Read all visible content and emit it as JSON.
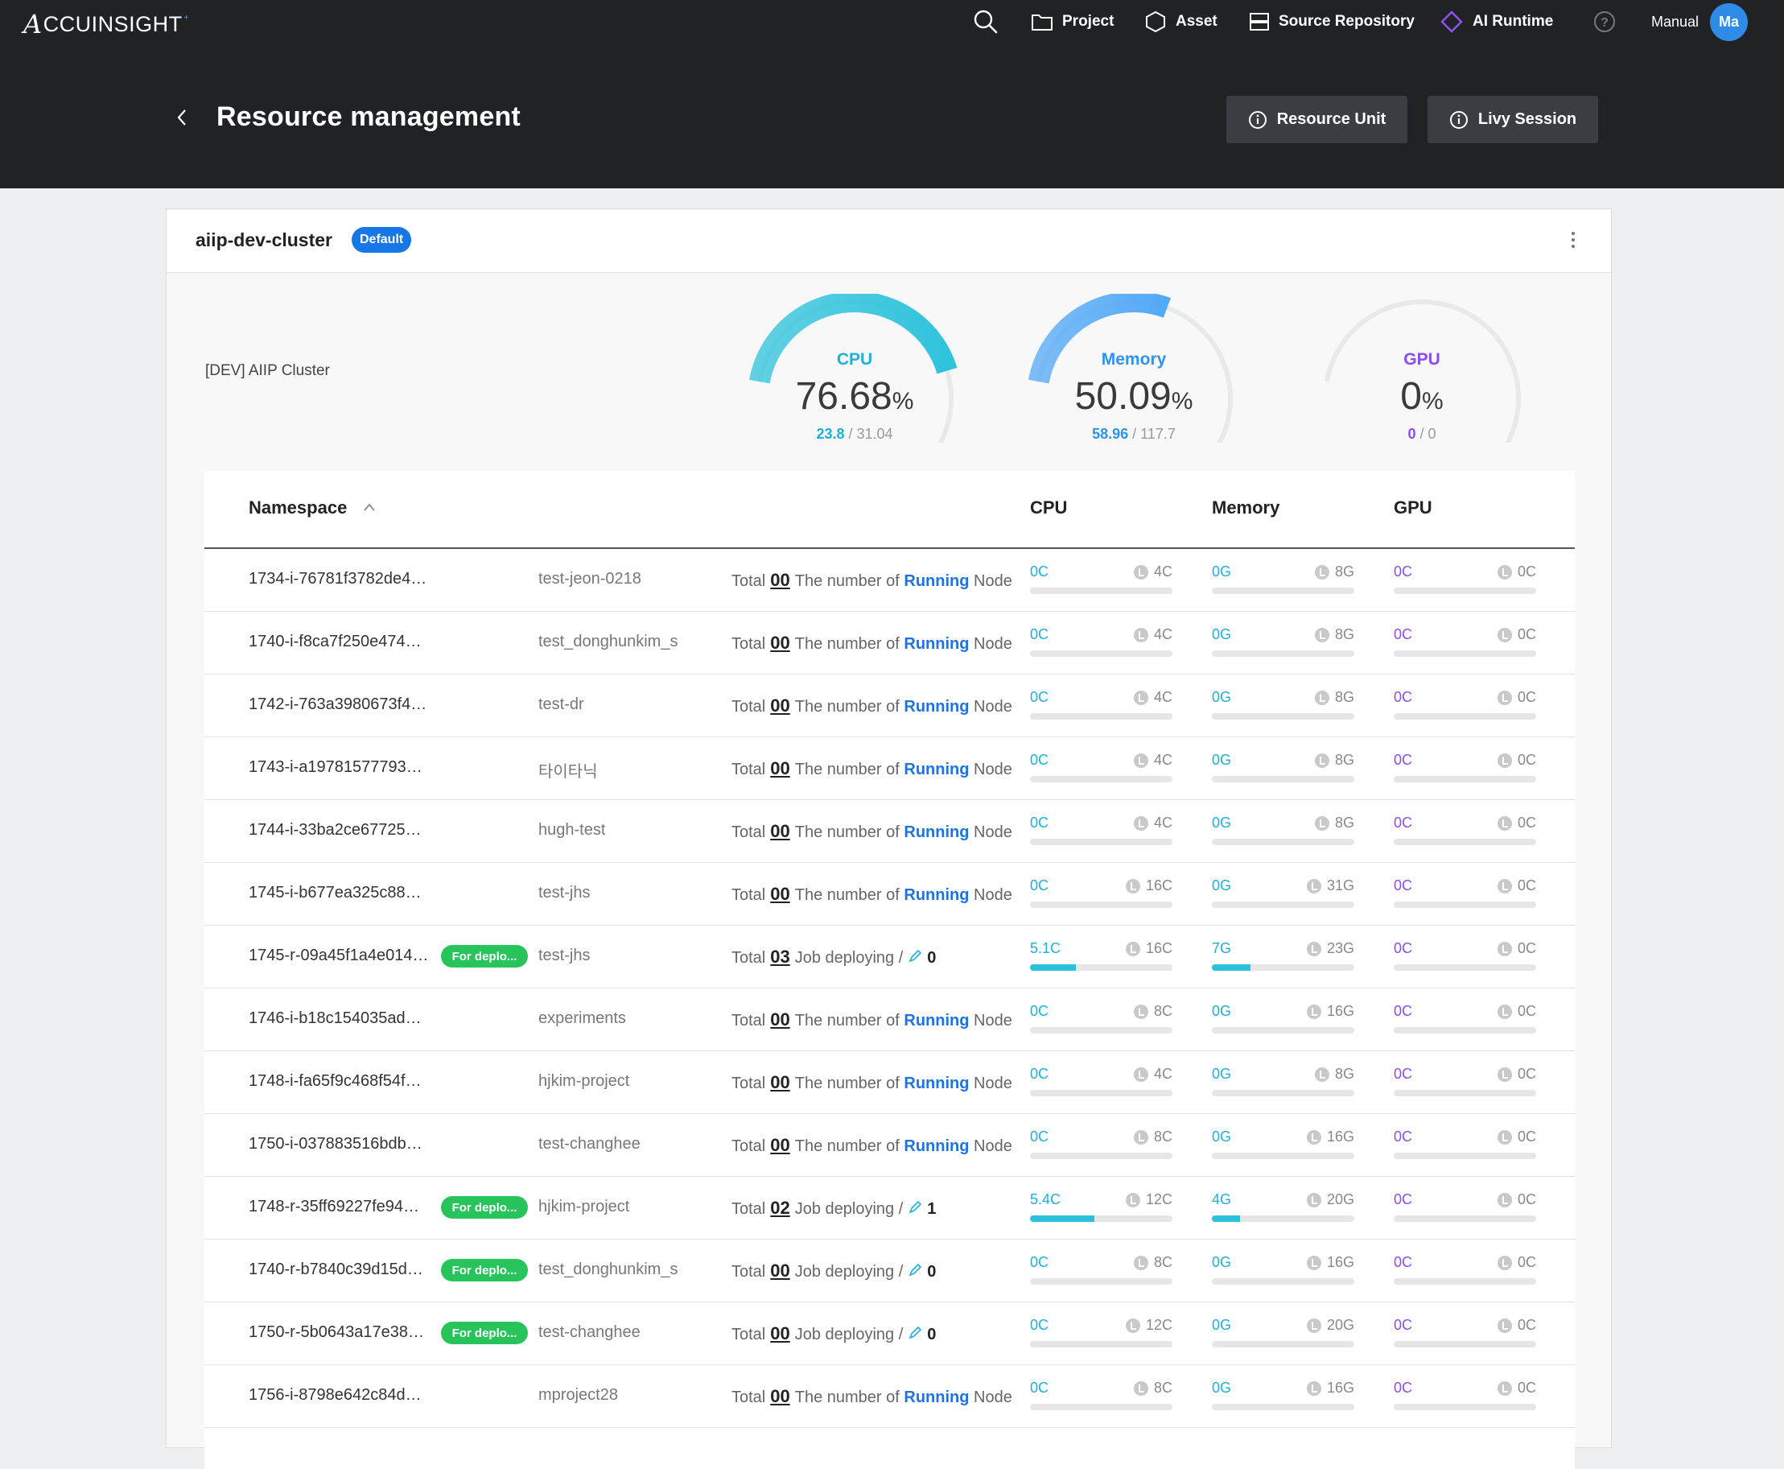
{
  "header": {
    "logo": "CCUINSIGHT",
    "logo_mark": "A",
    "nav": {
      "project": "Project",
      "asset": "Asset",
      "source_repository": "Source Repository",
      "ai_runtime": "AI Runtime"
    },
    "manual": "Manual",
    "avatar": "Ma",
    "page_title": "Resource management",
    "buttons": {
      "resource_unit": "Resource Unit",
      "livy_session": "Livy Session"
    }
  },
  "cluster": {
    "name": "aiip-dev-cluster",
    "badge": "Default",
    "description": "[DEV] AIIP Cluster",
    "gauges": {
      "cpu": {
        "label": "CPU",
        "value": "76.68",
        "unit": "%",
        "used": "23.8",
        "total": "31.04",
        "fraction": 0.7668,
        "color": "#2fc3dc"
      },
      "memory": {
        "label": "Memory",
        "value": "50.09",
        "unit": "%",
        "used": "58.96",
        "total": "117.7",
        "fraction": 0.5009,
        "color": "#52a9f7"
      },
      "gpu": {
        "label": "GPU",
        "value": "0",
        "unit": "%",
        "used": "0",
        "total": "0",
        "fraction": 0,
        "color": "#8a4df0"
      }
    }
  },
  "table": {
    "headers": {
      "namespace": "Namespace",
      "cpu": "CPU",
      "memory": "Memory",
      "gpu": "GPU"
    },
    "labels": {
      "total": "Total",
      "the_number_of": "The number of",
      "running": "Running",
      "node": "Node",
      "job_deploying": "Job deploying /"
    },
    "rows": [
      {
        "id": "1734-i-76781f3782de4…",
        "badge": "",
        "project": "test-jeon-0218",
        "kind": "running",
        "total": "00",
        "deploy": "",
        "cpu_used": "0C",
        "cpu_lim": "4C",
        "cpu_frac": 0,
        "mem_used": "0G",
        "mem_lim": "8G",
        "mem_frac": 0,
        "gpu_used": "0C",
        "gpu_lim": "0C"
      },
      {
        "id": "1740-i-f8ca7f250e474…",
        "badge": "",
        "project": "test_donghunkim_s",
        "kind": "running",
        "total": "00",
        "deploy": "",
        "cpu_used": "0C",
        "cpu_lim": "4C",
        "cpu_frac": 0,
        "mem_used": "0G",
        "mem_lim": "8G",
        "mem_frac": 0,
        "gpu_used": "0C",
        "gpu_lim": "0C"
      },
      {
        "id": "1742-i-763a3980673f4…",
        "badge": "",
        "project": "test-dr",
        "kind": "running",
        "total": "00",
        "deploy": "",
        "cpu_used": "0C",
        "cpu_lim": "4C",
        "cpu_frac": 0,
        "mem_used": "0G",
        "mem_lim": "8G",
        "mem_frac": 0,
        "gpu_used": "0C",
        "gpu_lim": "0C"
      },
      {
        "id": "1743-i-a19781577793…",
        "badge": "",
        "project": "타이타닉",
        "kind": "running",
        "total": "00",
        "deploy": "",
        "cpu_used": "0C",
        "cpu_lim": "4C",
        "cpu_frac": 0,
        "mem_used": "0G",
        "mem_lim": "8G",
        "mem_frac": 0,
        "gpu_used": "0C",
        "gpu_lim": "0C"
      },
      {
        "id": "1744-i-33ba2ce67725…",
        "badge": "",
        "project": "hugh-test",
        "kind": "running",
        "total": "00",
        "deploy": "",
        "cpu_used": "0C",
        "cpu_lim": "4C",
        "cpu_frac": 0,
        "mem_used": "0G",
        "mem_lim": "8G",
        "mem_frac": 0,
        "gpu_used": "0C",
        "gpu_lim": "0C"
      },
      {
        "id": "1745-i-b677ea325c88…",
        "badge": "",
        "project": "test-jhs",
        "kind": "running",
        "total": "00",
        "deploy": "",
        "cpu_used": "0C",
        "cpu_lim": "16C",
        "cpu_frac": 0,
        "mem_used": "0G",
        "mem_lim": "31G",
        "mem_frac": 0,
        "gpu_used": "0C",
        "gpu_lim": "0C"
      },
      {
        "id": "1745-r-09a45f1a4e014…",
        "badge": "For deplo...",
        "project": "test-jhs",
        "kind": "deploying",
        "total": "03",
        "deploy": "0",
        "cpu_used": "5.1C",
        "cpu_lim": "16C",
        "cpu_frac": 0.32,
        "mem_used": "7G",
        "mem_lim": "23G",
        "mem_frac": 0.27,
        "gpu_used": "0C",
        "gpu_lim": "0C"
      },
      {
        "id": "1746-i-b18c154035ad…",
        "badge": "",
        "project": "experiments",
        "kind": "running",
        "total": "00",
        "deploy": "",
        "cpu_used": "0C",
        "cpu_lim": "8C",
        "cpu_frac": 0,
        "mem_used": "0G",
        "mem_lim": "16G",
        "mem_frac": 0,
        "gpu_used": "0C",
        "gpu_lim": "0C"
      },
      {
        "id": "1748-i-fa65f9c468f54f…",
        "badge": "",
        "project": "hjkim-project",
        "kind": "running",
        "total": "00",
        "deploy": "",
        "cpu_used": "0C",
        "cpu_lim": "4C",
        "cpu_frac": 0,
        "mem_used": "0G",
        "mem_lim": "8G",
        "mem_frac": 0,
        "gpu_used": "0C",
        "gpu_lim": "0C"
      },
      {
        "id": "1750-i-037883516bdb…",
        "badge": "",
        "project": "test-changhee",
        "kind": "running",
        "total": "00",
        "deploy": "",
        "cpu_used": "0C",
        "cpu_lim": "8C",
        "cpu_frac": 0,
        "mem_used": "0G",
        "mem_lim": "16G",
        "mem_frac": 0,
        "gpu_used": "0C",
        "gpu_lim": "0C"
      },
      {
        "id": "1748-r-35ff69227fe94…",
        "badge": "For deplo...",
        "project": "hjkim-project",
        "kind": "deploying",
        "total": "02",
        "deploy": "1",
        "cpu_used": "5.4C",
        "cpu_lim": "12C",
        "cpu_frac": 0.45,
        "mem_used": "4G",
        "mem_lim": "20G",
        "mem_frac": 0.2,
        "gpu_used": "0C",
        "gpu_lim": "0C"
      },
      {
        "id": "1740-r-b7840c39d15d…",
        "badge": "For deplo...",
        "project": "test_donghunkim_s",
        "kind": "deploying",
        "total": "00",
        "deploy": "0",
        "cpu_used": "0C",
        "cpu_lim": "8C",
        "cpu_frac": 0,
        "mem_used": "0G",
        "mem_lim": "16G",
        "mem_frac": 0,
        "gpu_used": "0C",
        "gpu_lim": "0C"
      },
      {
        "id": "1750-r-5b0643a17e38…",
        "badge": "For deplo...",
        "project": "test-changhee",
        "kind": "deploying",
        "total": "00",
        "deploy": "0",
        "cpu_used": "0C",
        "cpu_lim": "12C",
        "cpu_frac": 0,
        "mem_used": "0G",
        "mem_lim": "20G",
        "mem_frac": 0,
        "gpu_used": "0C",
        "gpu_lim": "0C"
      },
      {
        "id": "1756-i-8798e642c84d…",
        "badge": "",
        "project": "mproject28",
        "kind": "running",
        "total": "00",
        "deploy": "",
        "cpu_used": "0C",
        "cpu_lim": "8C",
        "cpu_frac": 0,
        "mem_used": "0G",
        "mem_lim": "16G",
        "mem_frac": 0,
        "gpu_used": "0C",
        "gpu_lim": "0C"
      }
    ]
  }
}
